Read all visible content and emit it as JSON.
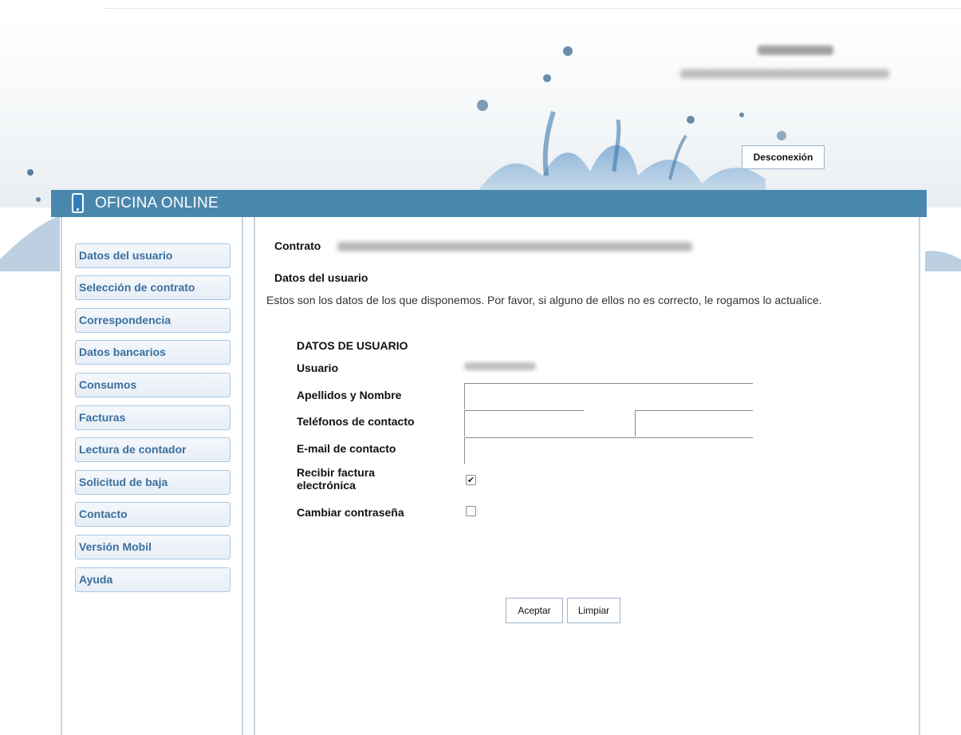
{
  "header": {
    "logout_label": "Desconexión"
  },
  "appbar": {
    "title": "OFICINA ONLINE",
    "icon": "phone-icon"
  },
  "sidebar": {
    "items": [
      {
        "label": "Datos del usuario"
      },
      {
        "label": "Selección de contrato"
      },
      {
        "label": "Correspondencia"
      },
      {
        "label": "Datos bancarios"
      },
      {
        "label": "Consumos"
      },
      {
        "label": "Facturas"
      },
      {
        "label": "Lectura de contador"
      },
      {
        "label": "Solicitud de baja"
      },
      {
        "label": "Contacto"
      },
      {
        "label": "Versión Mobil"
      },
      {
        "label": "Ayuda"
      }
    ]
  },
  "main": {
    "contract_label": "Contrato",
    "section_title": "Datos del usuario",
    "intro_text": "Estos son los datos de los que disponemos. Por favor, si alguno de ellos no es correcto, le rogamos lo actualice.",
    "form": {
      "heading": "DATOS DE USUARIO",
      "usuario_label": "Usuario",
      "nombre_label": "Apellidos y Nombre",
      "telefonos_label": "Teléfonos de contacto",
      "email_label": "E-mail de contacto",
      "factura_label_line1": "Recibir factura",
      "factura_label_line2": "electrónica",
      "factura_checked": true,
      "factura_mark": "✔",
      "password_label": "Cambiar contraseña",
      "password_checked": false
    },
    "buttons": {
      "accept": "Aceptar",
      "clear": "Limpiar"
    }
  },
  "colors": {
    "appbar": "#4a87ad",
    "menu_text": "#3a6f9e",
    "menu_border": "#a9c7e3"
  }
}
